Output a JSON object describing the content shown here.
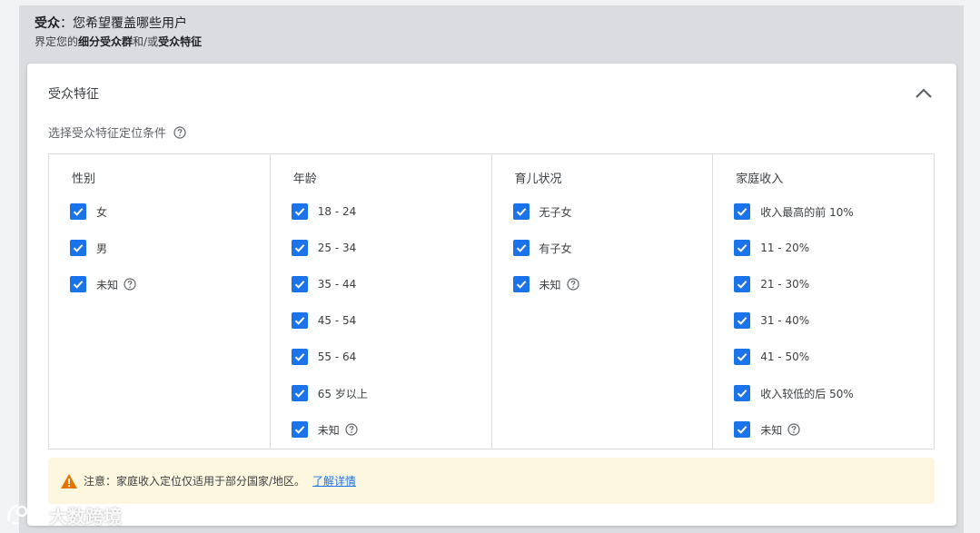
{
  "header": {
    "title_bold": "受众",
    "title_rest": "：您希望覆盖哪些用户",
    "desc_1": "界定您的",
    "desc_bold_1": "细分受众群",
    "desc_2": "和/或",
    "desc_bold_2": "受众特征"
  },
  "card": {
    "title": "受众特征",
    "subtitle": "选择受众特征定位条件"
  },
  "columns": [
    {
      "title": "性别",
      "options": [
        "女",
        "男",
        "未知"
      ]
    },
    {
      "title": "年龄",
      "options": [
        "18 - 24",
        "25 - 34",
        "35 - 44",
        "45 - 54",
        "55 - 64",
        "65 岁以上",
        "未知"
      ]
    },
    {
      "title": "育儿状况",
      "options": [
        "无子女",
        "有子女",
        "未知"
      ]
    },
    {
      "title": "家庭收入",
      "options": [
        "收入最高的前 10%",
        "11 - 20%",
        "21 - 30%",
        "31 - 40%",
        "41 - 50%",
        "收入较低的后 50%",
        "未知"
      ]
    }
  ],
  "notice": {
    "text": "注意：家庭收入定位仅适用于部分国家/地区。",
    "link": "了解详情"
  },
  "watermark": {
    "text": "大数跨境"
  },
  "colors": {
    "checkbox": "#1a73e8",
    "warning": "#e37400",
    "notice_bg": "#fef7e0",
    "link": "#1a73e8"
  },
  "icons": {
    "collapse": "chevron-up-icon",
    "help": "help-circle-icon",
    "warning": "warning-triangle-icon",
    "checked": "check-icon"
  }
}
